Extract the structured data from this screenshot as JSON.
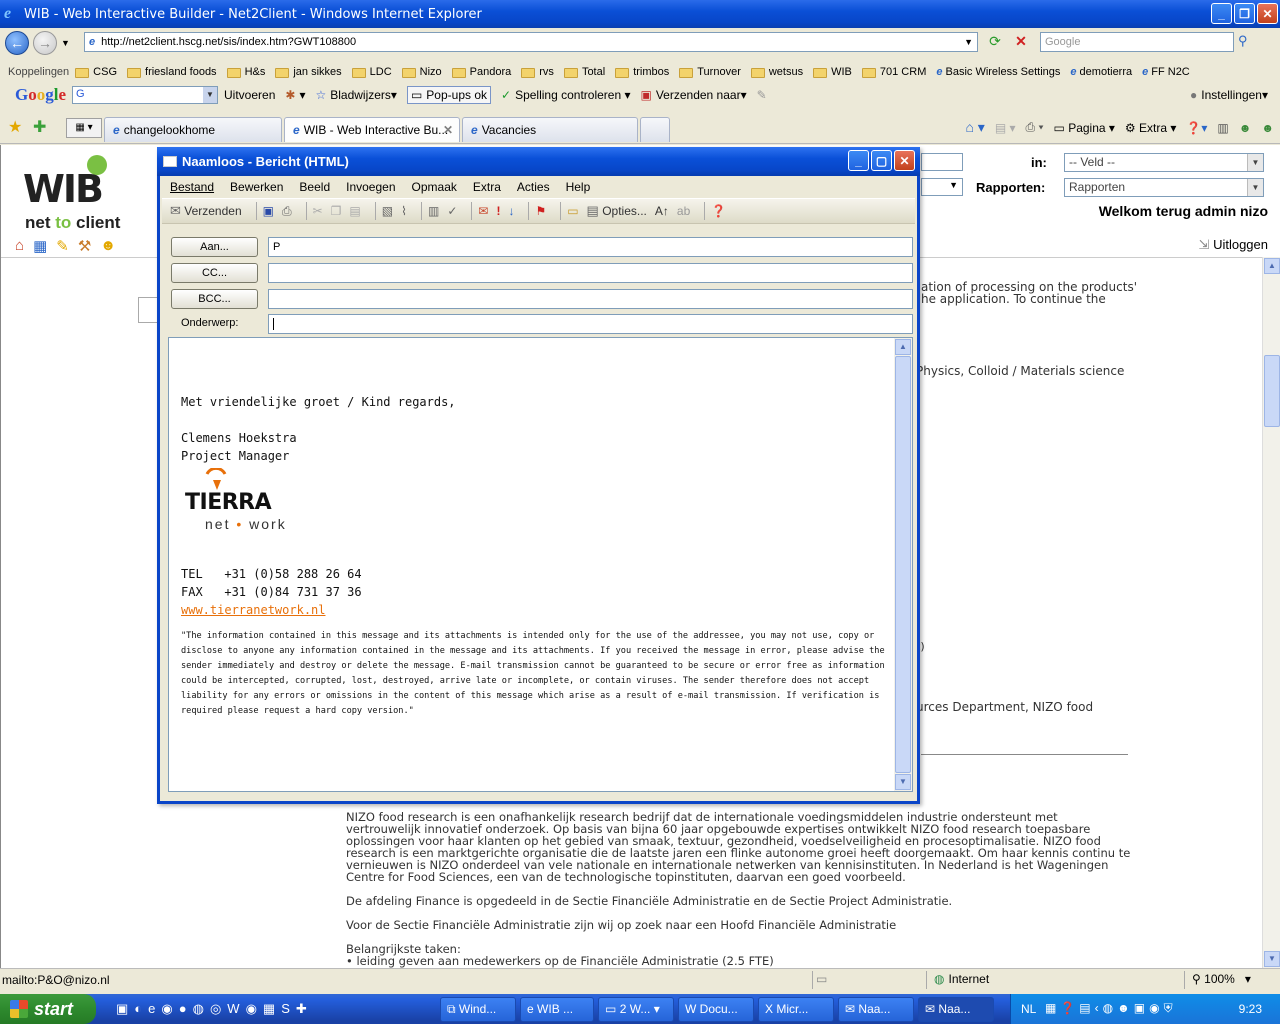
{
  "browser": {
    "title": "WIB - Web Interactive Builder - Net2Client - Windows Internet Explorer",
    "address": "http://net2client.hscg.net/sis/index.htm?GWT108800",
    "search_placeholder": "Google",
    "links_label": "Koppelingen",
    "links": [
      "CSG",
      "friesland foods",
      "H&s",
      "jan sikkes",
      "LDC",
      "Nizo",
      "Pandora",
      "rvs",
      "Total",
      "trimbos",
      "Turnover",
      "wetsus",
      "WIB",
      "701 CRM",
      "Basic Wireless Settings",
      "demotierra",
      "FF N2C"
    ],
    "google_toolbar": {
      "search_value": "G",
      "items": [
        "Uitvoeren",
        "Bladwijzers",
        "Pop-ups ok",
        "Spelling controleren",
        "Verzenden naar",
        "Instellingen"
      ]
    },
    "tabs": [
      "changelookhome",
      "WIB - Web Interactive Bu...",
      "Vacancies"
    ],
    "commands": [
      "Pagina",
      "Extra"
    ]
  },
  "page": {
    "logo_letters": "WIB",
    "logo_tag_net": "net",
    "logo_tag_to": "to",
    "logo_tag_client": "client",
    "in_label": "in:",
    "veld_select": "-- Veld --",
    "rapporten_label": "Rapporten:",
    "rapporten_select": "Rapporten",
    "welcome": "Welkom terug admin nizo",
    "logout": "Uitloggen",
    "frag1": "ation of processing on the products'",
    "frag2": "he application. To continue the",
    "frag3": "Physics, Colloid / Materials science",
    "frag4": "t)",
    "frag5": "urces Department, NIZO food",
    "body_para1": "NIZO food research is een onafhankelijk research bedrijf dat de internationale voedingsmiddelen industrie ondersteunt met vertrouwelijk innovatief onderzoek. Op basis van bijna 60 jaar opgebouwde expertises ontwikkelt NIZO food research toepasbare oplossingen voor haar klanten op het gebied van smaak, textuur, gezondheid, voedselveiligheid en procesoptimalisatie. NIZO food research is een marktgerichte organisatie die de laatste jaren een flinke autonome groei heeft doorgemaakt. Om haar kennis continu te vernieuwen is NIZO onderdeel van vele nationale en internationale netwerken van kennisinstituten. In Nederland is het Wageningen Centre for Food Sciences, een van de technologische topinstituten, daarvan een goed voorbeeld.",
    "body_para2": "De afdeling Finance is opgedeeld in de Sectie Financiële Administratie en de Sectie Project Administratie.",
    "body_para3": "Voor de Sectie Financiële Administratie zijn wij op zoek naar een Hoofd Financiële Administratie",
    "body_para4a": "Belangrijkste taken:",
    "body_para4b": "• leiding geven aan medewerkers op de Financiële Administratie (2.5 FTE)"
  },
  "mail": {
    "title": "Naamloos - Bericht (HTML)",
    "menu": [
      "Bestand",
      "Bewerken",
      "Beeld",
      "Invoegen",
      "Opmaak",
      "Extra",
      "Acties",
      "Help"
    ],
    "send_label": "Verzenden",
    "options_label": "Opties...",
    "to_label": "Aan...",
    "to_value": "P",
    "cc_label": "CC...",
    "bcc_label": "BCC...",
    "subject_label": "Onderwerp:",
    "subject_value": "",
    "greeting": "Met vriendelijke groet / Kind regards,",
    "name": "Clemens Hoekstra",
    "role": "Project Manager",
    "logo_name": "TIERRA",
    "logo_sub_a": "net",
    "logo_sub_dot": "•",
    "logo_sub_b": "work",
    "tel": "TEL   +31 (0)58 288 26 64",
    "fax": "FAX   +31 (0)84 731 37 36",
    "website": "www.tierranetwork.nl",
    "disclaimer": "\"The information contained in this message and its attachments is intended only for the use of the addressee, you may not use, copy or disclose to anyone any information contained in the message and its attachments. If you received the message in error, please advise the sender immediately and destroy or delete the message. E-mail transmission cannot be guaranteed to be secure or error free as information could be intercepted, corrupted, lost, destroyed, arrive late or incomplete, or contain viruses. The sender therefore does not accept liability for any errors or omissions in the content of this message which arise as a result of e-mail transmission. If verification is required please request a hard copy version.\""
  },
  "status": {
    "text": "mailto:P&O@nizo.nl",
    "zone": "Internet",
    "zoom": "100%"
  },
  "taskbar": {
    "start": "start",
    "tasks": [
      "Wind...",
      "WIB ...",
      "2 W...",
      "Docu...",
      "Micr...",
      "Naa...",
      "Naa..."
    ],
    "lang": "NL",
    "clock": "9:23"
  }
}
